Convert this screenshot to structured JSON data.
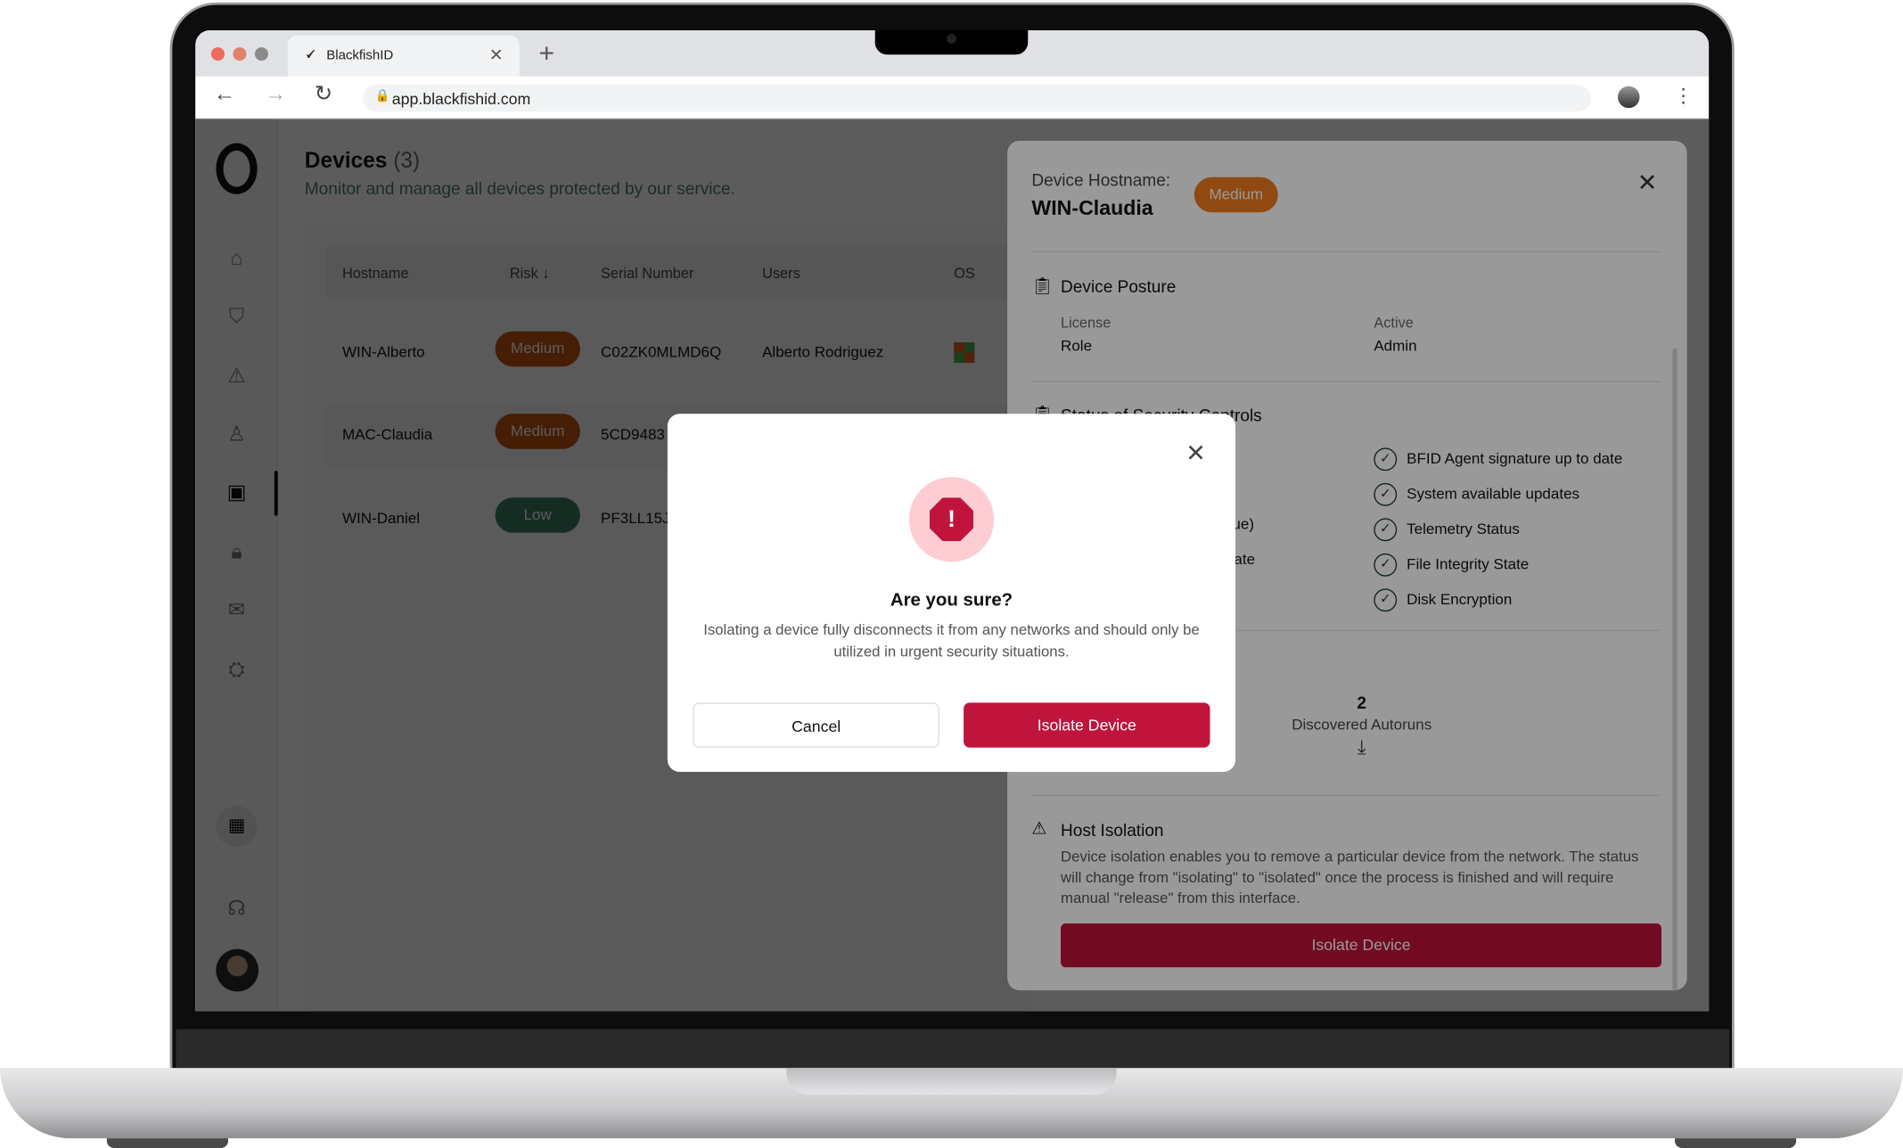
{
  "browser": {
    "tab_title": "BlackfishID",
    "url": "app.blackfishid.com"
  },
  "page": {
    "title": "Devices",
    "count": "(3)",
    "subtitle": "Monitor and manage all devices protected by our service."
  },
  "table": {
    "columns": [
      "Hostname",
      "Risk",
      "Serial Number",
      "Users",
      "OS"
    ],
    "rows": [
      {
        "hostname": "WIN-Alberto",
        "risk": "Medium",
        "serial": "C02ZK0MLMD6Q",
        "user": "Alberto Rodriguez",
        "os": "windows"
      },
      {
        "hostname": "MAC-Claudia",
        "risk": "Medium",
        "serial": "5CD9483"
      },
      {
        "hostname": "WIN-Daniel",
        "risk": "Low",
        "serial": "PF3LL15J"
      }
    ]
  },
  "colors": {
    "medium": "#c2500f",
    "low": "#3a7a5e",
    "danger": "#c1143c",
    "danger_soft": "#fecdd3"
  },
  "panel": {
    "hostname_label": "Device Hostname:",
    "hostname": "WIN-Claudia",
    "risk": "Medium",
    "posture": {
      "title": "Device Posture",
      "license_label": "License",
      "license_value": "Active",
      "role_label": "Role",
      "role_value": "Admin"
    },
    "controls": {
      "title": "Status of Security Controls",
      "left_partial": [
        "e)",
        "issue)",
        "t State"
      ],
      "right": [
        "BFID Agent signature up to date",
        "System available updates",
        "Telemetry Status",
        "File Integrity State",
        "Disk Encryption"
      ]
    },
    "autoruns": {
      "count": "2",
      "label": "Discovered Autoruns"
    },
    "isolation": {
      "title": "Host Isolation",
      "text": "Device isolation enables you to remove a particular device from the network. The status will change from \"isolating\" to \"isolated\" once the process is finished and will require manual \"release\" from this interface.",
      "button": "Isolate Device"
    }
  },
  "modal": {
    "title": "Are you sure?",
    "text": "Isolating a device fully disconnects it from any networks and should only be utilized in urgent security situations.",
    "cancel": "Cancel",
    "confirm": "Isolate Device"
  }
}
